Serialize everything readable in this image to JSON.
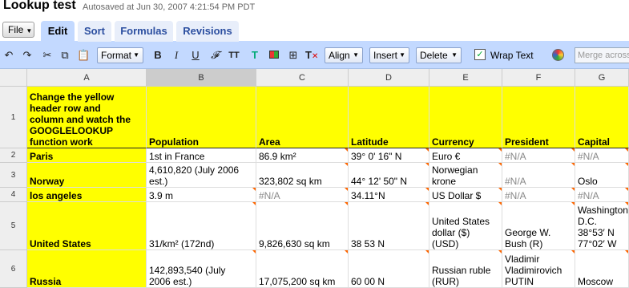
{
  "header": {
    "title": "Lookup test",
    "autosave": "Autosaved at Jun 30, 2007 4:21:54 PM PDT"
  },
  "menu": {
    "file_label": "File"
  },
  "tabs": [
    {
      "label": "Edit"
    },
    {
      "label": "Sort"
    },
    {
      "label": "Formulas"
    },
    {
      "label": "Revisions"
    }
  ],
  "toolbar": {
    "format_label": "Format",
    "align_label": "Align",
    "insert_label": "Insert",
    "delete_label": "Delete",
    "wrap_label": "Wrap Text",
    "merge_label": "Merge across",
    "icons": [
      "undo-icon",
      "redo-icon",
      "cut-icon",
      "copy-icon",
      "paste-icon",
      "bold-icon",
      "italic-icon",
      "underline-icon",
      "font-icon",
      "font-size-icon",
      "text-color-icon",
      "background-color-icon",
      "borders-icon",
      "clear-format-icon",
      "palette-icon"
    ]
  },
  "sheet": {
    "columns": [
      "A",
      "B",
      "C",
      "D",
      "E",
      "F",
      "G"
    ],
    "rows": [
      "1",
      "2",
      "3",
      "4",
      "5",
      "6"
    ],
    "cells": [
      [
        "Change the yellow\nheader row and\ncolumn and watch the\nGOOGLELOOKUP\nfunction work",
        "Population",
        "Area",
        "Latitude",
        "Currency",
        "President",
        "Capital"
      ],
      [
        "Paris",
        "1st in France",
        "86.9 km²",
        "39° 0' 16\" N",
        "Euro €",
        "#N/A",
        "#N/A"
      ],
      [
        "Norway",
        "4,610,820 (July 2006\nest.)",
        "323,802 sq km",
        "44° 12' 50\" N",
        "Norwegian\nkrone",
        "#N/A",
        "Oslo"
      ],
      [
        "los angeles",
        "3.9 m",
        "#N/A",
        "34.11°N",
        "US Dollar $",
        "#N/A",
        "#N/A"
      ],
      [
        "United States",
        "31/km² (172nd)",
        "9,826,630 sq km",
        "38 53 N",
        "United States\ndollar ($)\n(USD)",
        "George W.\nBush (R)",
        "Washington\nD.C.\n38°53′ N\n77°02′ W"
      ],
      [
        "Russia",
        "142,893,540 (July\n2006 est.)",
        "17,075,200 sq km",
        "60 00 N",
        "Russian ruble\n(RUR)",
        "Vladimir\nVladimirovich\nPUTIN",
        "Moscow"
      ]
    ]
  }
}
